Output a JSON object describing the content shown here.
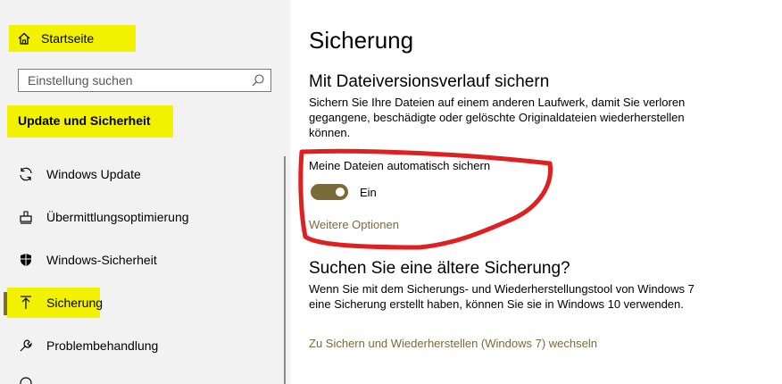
{
  "sidebar": {
    "home_label": "Startseite",
    "search_placeholder": "Einstellung suchen",
    "section_title": "Update und Sicherheit",
    "items": [
      {
        "label": "Windows Update",
        "icon": "refresh-icon"
      },
      {
        "label": "Übermittlungsoptimierung",
        "icon": "delivery-optimization-icon"
      },
      {
        "label": "Windows-Sicherheit",
        "icon": "shield-icon"
      },
      {
        "label": "Sicherung",
        "icon": "backup-upload-icon",
        "active": true
      },
      {
        "label": "Problembehandlung",
        "icon": "wrench-icon"
      }
    ]
  },
  "main": {
    "page_title": "Sicherung",
    "file_history": {
      "heading": "Mit Dateiversionsverlauf sichern",
      "description": "Sichern Sie Ihre Dateien auf einem anderen Laufwerk, damit Sie verloren gegangene, beschädigte oder gelöschte Originaldateien wiederherstellen können.",
      "auto_backup_label": "Meine Dateien automatisch sichern",
      "toggle_state": "Ein",
      "toggle_on": true,
      "more_options": "Weitere Optionen"
    },
    "older_backup": {
      "heading": "Suchen Sie eine ältere Sicherung?",
      "description": "Wenn Sie mit dem Sicherungs- und Wiederherstellungstool von Windows 7 eine Sicherung erstellt haben, können Sie sie in Windows 10 verwenden.",
      "link": "Zu Sichern und Wiederherstellen (Windows 7) wechseln"
    }
  },
  "colors": {
    "accent": "#7a6b3a",
    "highlight": "#f2f200",
    "annotation": "#e02020"
  }
}
